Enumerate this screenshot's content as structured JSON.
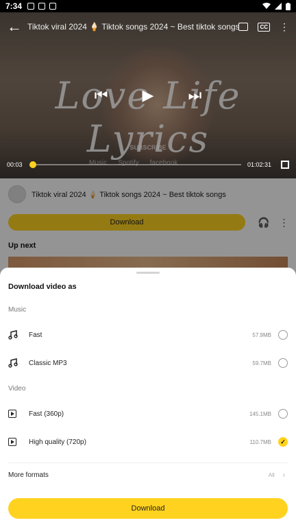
{
  "status_bar": {
    "time": "7:34"
  },
  "video": {
    "title": "Tiktok viral 2024 🍦 Tiktok songs 2024 ~ Best tiktok songs",
    "overlay_text": "Love Life Lyrics",
    "subscribe_text": "SUBSCRIBE",
    "socials": [
      "Music",
      "Spotify",
      "facebook"
    ],
    "time_current": "00:03",
    "time_total": "01:02:31",
    "progress_fraction": 0.0008
  },
  "details": {
    "title": "Tiktok viral 2024 🍦 Tiktok songs 2024 ~ Best tiktok songs",
    "download_label": "Download",
    "up_next_label": "Up next"
  },
  "sheet": {
    "title": "Download video as",
    "music_label": "Music",
    "video_label": "Video",
    "music_options": [
      {
        "label": "Fast",
        "size": "57.9MB",
        "icon": "music-note-icon",
        "selected": false
      },
      {
        "label": "Classic MP3",
        "size": "59.7MB",
        "icon": "music-note-icon",
        "selected": false
      }
    ],
    "video_options": [
      {
        "label": "Fast (360p)",
        "size": "145.1MB",
        "icon": "play-box-icon",
        "selected": false
      },
      {
        "label": "High quality (720p)",
        "size": "110.7MB",
        "icon": "play-box-icon",
        "selected": true
      }
    ],
    "more_formats_label": "More formats",
    "more_formats_value": "All",
    "download_label": "Download"
  },
  "colors": {
    "accent": "#ffd21f"
  }
}
